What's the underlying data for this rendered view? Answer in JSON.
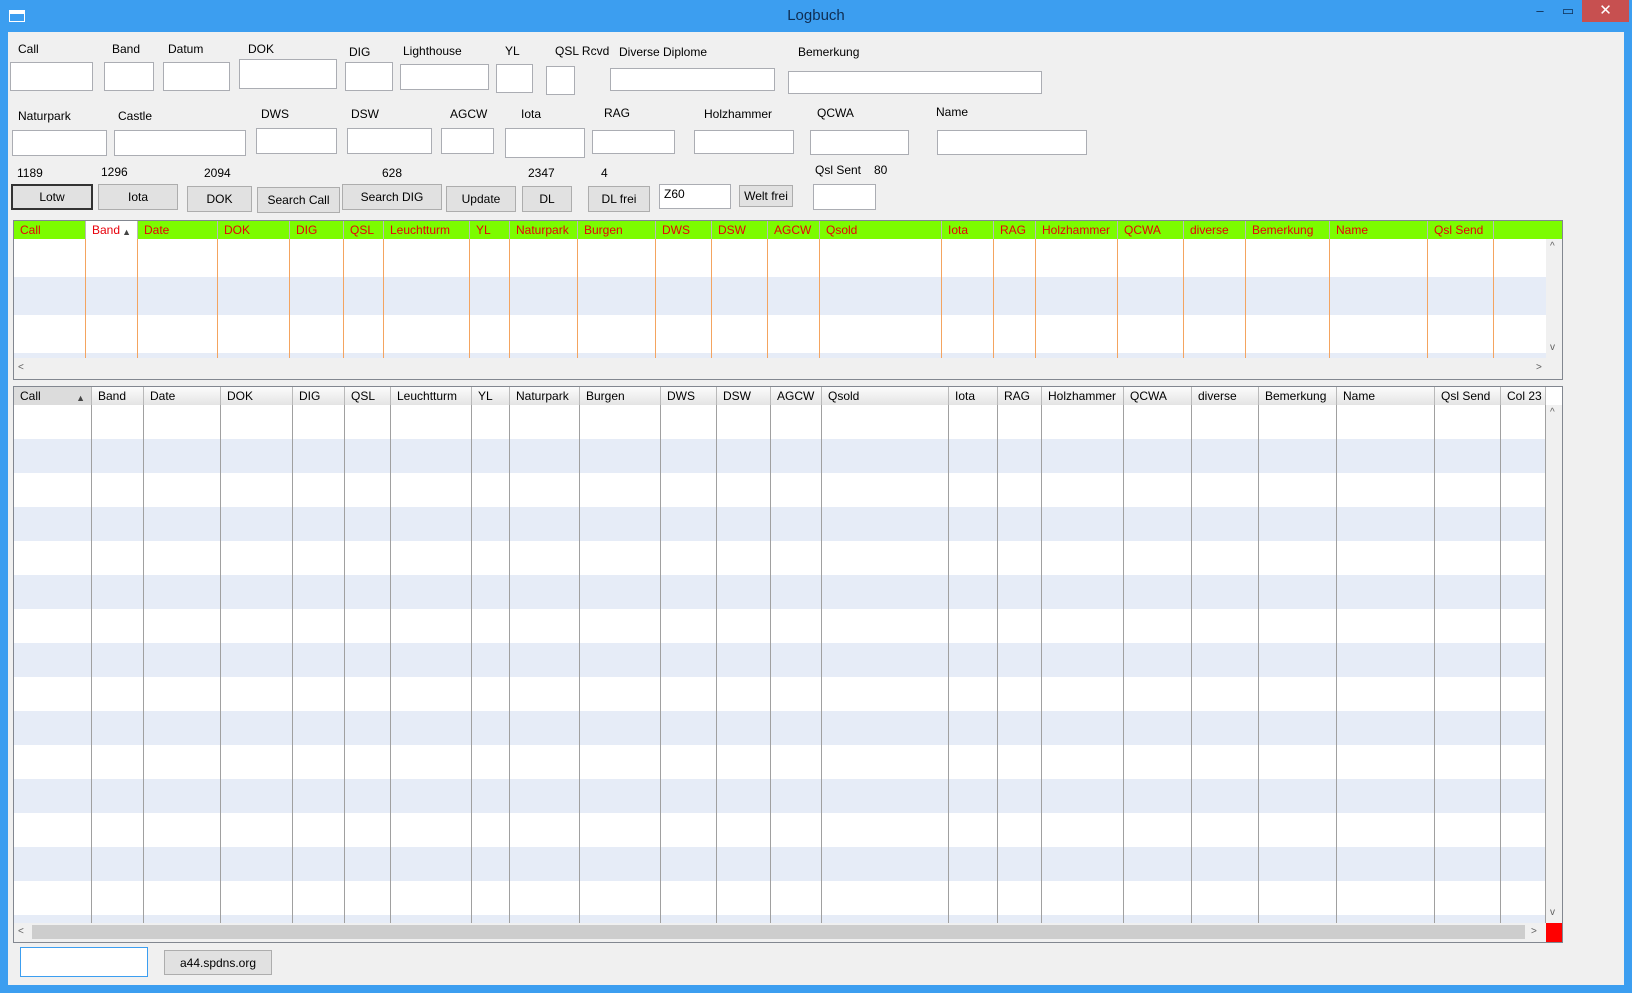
{
  "window": {
    "title": "Logbuch",
    "min_glyph": "–",
    "max_glyph": "▭",
    "close_glyph": "✕"
  },
  "labels": {
    "call": "Call",
    "band": "Band",
    "datum": "Datum",
    "dok": "DOK",
    "dig": "DIG",
    "lighthouse": "Lighthouse",
    "yl": "YL",
    "qsl_rcvd": "QSL Rcvd",
    "diverse_diplome": "Diverse Diplome",
    "bemerkung": "Bemerkung",
    "naturpark": "Naturpark",
    "castle": "Castle",
    "dws": "DWS",
    "dsw": "DSW",
    "agcw": "AGCW",
    "iota": "Iota",
    "rag": "RAG",
    "holzhammer": "Holzhammer",
    "qcwa": "QCWA",
    "name": "Name",
    "qsl_sent": "Qsl Sent"
  },
  "counts": {
    "lotw": "1189",
    "iota": "1296",
    "dok": "2094",
    "dig": "628",
    "dl": "2347",
    "dl_frei": "4",
    "qsl_sent": "80"
  },
  "buttons": {
    "lotw": "Lotw",
    "iota": "Iota",
    "dok": "DOK",
    "search_call": "Search Call",
    "search_dig": "Search DIG",
    "update": "Update",
    "dl": "DL",
    "dl_frei": "DL frei",
    "welt_frei": "Welt frei",
    "server": "a44.spdns.org"
  },
  "inputs": {
    "prefix": "Z60"
  },
  "grid_top": {
    "columns": [
      "Call",
      "Band",
      "Date",
      "DOK",
      "DIG",
      "QSL",
      "Leuchtturm",
      "YL",
      "Naturpark",
      "Burgen",
      "DWS",
      "DSW",
      "AGCW",
      "Qsold",
      "Iota",
      "RAG",
      "Holzhammer",
      "QCWA",
      "diverse",
      "Bemerkung",
      "Name",
      "Qsl Send"
    ],
    "sorted_column": "Band",
    "header_bg": "#7cfc00",
    "header_text": "#e8000b"
  },
  "grid_bottom": {
    "columns": [
      "Call",
      "Band",
      "Date",
      "DOK",
      "DIG",
      "QSL",
      "Leuchtturm",
      "YL",
      "Naturpark",
      "Burgen",
      "DWS",
      "DSW",
      "AGCW",
      "Qsold",
      "Iota",
      "RAG",
      "Holzhammer",
      "QCWA",
      "diverse",
      "Bemerkung",
      "Name",
      "Qsl Send",
      "Col 23"
    ],
    "sorted_column": "Call"
  },
  "icons": {
    "sort_up": "▲",
    "scroll_up": "^",
    "scroll_down": "v",
    "scroll_left": "<",
    "scroll_right": ">"
  },
  "colors": {
    "title_bar": "#3c9ef0",
    "close_button": "#c75050",
    "row_alt": "#e6ecf7",
    "indicator": "#ff0000"
  }
}
